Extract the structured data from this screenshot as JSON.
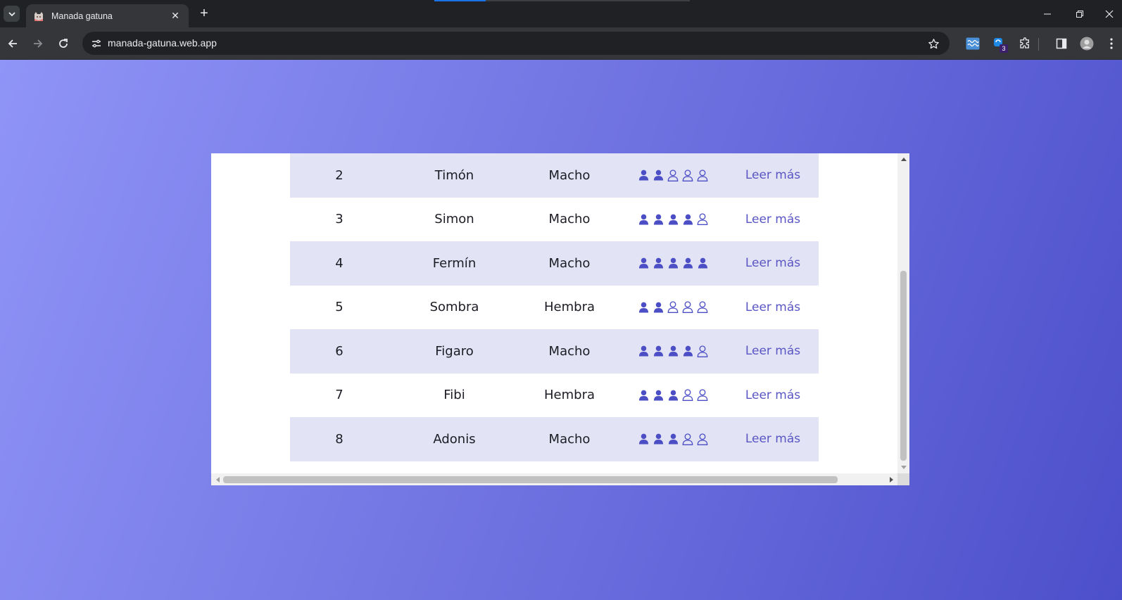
{
  "browser": {
    "tab_title": "Manada gatuna",
    "url": "manada-gatuna.web.app",
    "extension_badge": "3"
  },
  "table": {
    "rows": [
      {
        "num": "2",
        "name": "Timón",
        "sex": "Macho",
        "rating": 2,
        "link": "Leer más"
      },
      {
        "num": "3",
        "name": "Simon",
        "sex": "Macho",
        "rating": 4,
        "link": "Leer más"
      },
      {
        "num": "4",
        "name": "Fermín",
        "sex": "Macho",
        "rating": 5,
        "link": "Leer más"
      },
      {
        "num": "5",
        "name": "Sombra",
        "sex": "Hembra",
        "rating": 2,
        "link": "Leer más"
      },
      {
        "num": "6",
        "name": "Figaro",
        "sex": "Macho",
        "rating": 4,
        "link": "Leer más"
      },
      {
        "num": "7",
        "name": "Fibi",
        "sex": "Hembra",
        "rating": 3,
        "link": "Leer más"
      },
      {
        "num": "8",
        "name": "Adonis",
        "sex": "Macho",
        "rating": 3,
        "link": "Leer más"
      }
    ],
    "rating_max": 5
  },
  "icons": {
    "rating_filled": "person-filled-icon",
    "rating_empty": "person-outline-icon"
  },
  "colors": {
    "accent": "#4b4ec4",
    "link": "#5a56c4",
    "row_alt": "#e2e3f5",
    "gradient_start": "#8f94f7",
    "gradient_end": "#4c4fca"
  }
}
